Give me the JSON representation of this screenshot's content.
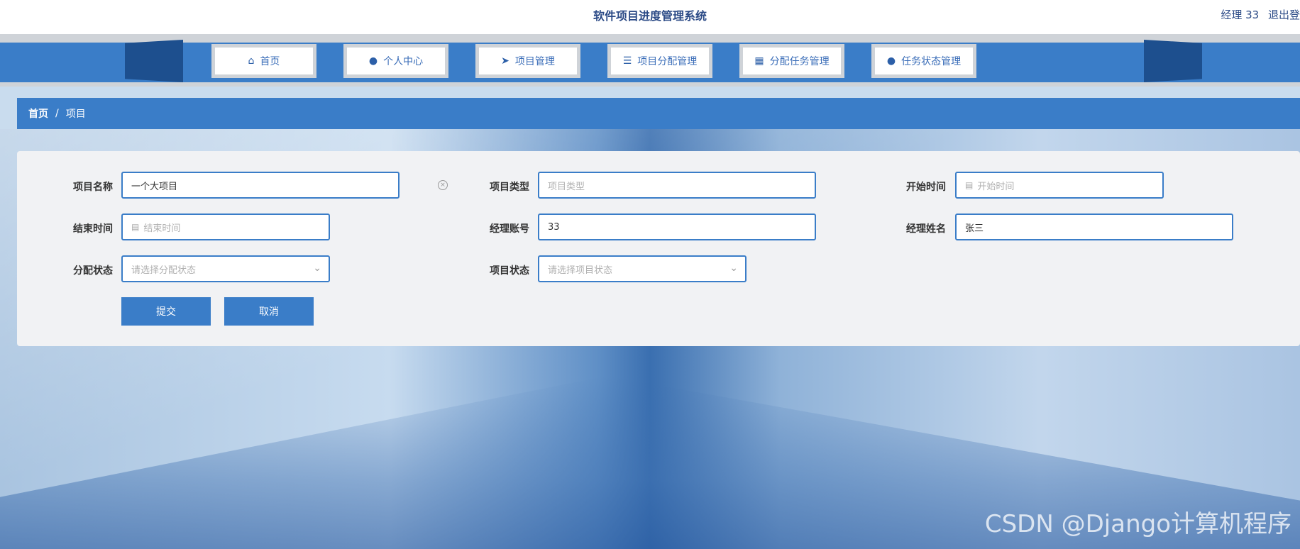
{
  "app": {
    "title": "软件项目进度管理系统"
  },
  "user": {
    "role_label": "经理 33",
    "logout": "退出登"
  },
  "nav": [
    {
      "label": "首页",
      "icon": "home-icon",
      "glyph": "⌂"
    },
    {
      "label": "个人中心",
      "icon": "user-icon",
      "glyph": "●"
    },
    {
      "label": "项目管理",
      "icon": "paper-plane-icon",
      "glyph": "➤"
    },
    {
      "label": "项目分配管理",
      "icon": "sliders-icon",
      "glyph": "☰"
    },
    {
      "label": "分配任务管理",
      "icon": "grid-icon",
      "glyph": "▦"
    },
    {
      "label": "任务状态管理",
      "icon": "user-icon",
      "glyph": "●"
    }
  ],
  "breadcrumb": {
    "home": "首页",
    "separator": "/",
    "current": "项目"
  },
  "form": {
    "project_name": {
      "label": "项目名称",
      "value": "一个大项目"
    },
    "project_type": {
      "label": "项目类型",
      "placeholder": "项目类型"
    },
    "start_time": {
      "label": "开始时间",
      "placeholder": "开始时间"
    },
    "end_time": {
      "label": "结束时间",
      "placeholder": "结束时间"
    },
    "manager_account": {
      "label": "经理账号",
      "value": "33"
    },
    "manager_name": {
      "label": "经理姓名",
      "value": "张三"
    },
    "assign_status": {
      "label": "分配状态",
      "placeholder": "请选择分配状态"
    },
    "project_status": {
      "label": "项目状态",
      "placeholder": "请选择项目状态"
    },
    "submit": "提交",
    "cancel": "取消"
  },
  "watermark": "CSDN @Django计算机程序",
  "colors": {
    "primary": "#3a7dc8",
    "nav_dark": "#1d4f8e",
    "title": "#2b4a86"
  }
}
